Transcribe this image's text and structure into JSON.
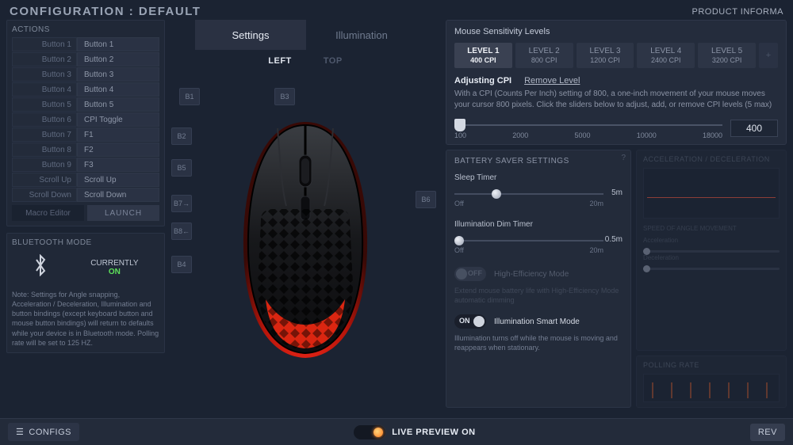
{
  "header": {
    "title": "CONFIGURATION : DEFAULT",
    "right": "PRODUCT INFORMA"
  },
  "actions": {
    "title": "ACTIONS",
    "rows": [
      {
        "label": "Button 1",
        "value": "Button 1"
      },
      {
        "label": "Button 2",
        "value": "Button 2"
      },
      {
        "label": "Button 3",
        "value": "Button 3"
      },
      {
        "label": "Button 4",
        "value": "Button 4"
      },
      {
        "label": "Button 5",
        "value": "Button 5"
      },
      {
        "label": "Button 6",
        "value": "CPI Toggle"
      },
      {
        "label": "Button 7",
        "value": "F1"
      },
      {
        "label": "Button 8",
        "value": "F2"
      },
      {
        "label": "Button 9",
        "value": "F3"
      },
      {
        "label": "Scroll Up",
        "value": "Scroll Up"
      },
      {
        "label": "Scroll Down",
        "value": "Scroll Down"
      }
    ],
    "macro_label": "Macro Editor",
    "launch": "LAUNCH"
  },
  "bluetooth": {
    "title": "BLUETOOTH MODE",
    "currently": "CURRENTLY",
    "on": "ON",
    "note": "Note: Settings for Angle snapping, Acceleration / Deceleration, Illumination and button bindings (except keyboard button and mouse button bindings) will return to defaults while your device is in Bluetooth mode. Polling rate will be set to 125 HZ."
  },
  "center": {
    "tabs": {
      "settings": "Settings",
      "illumination": "Illumination"
    },
    "view": {
      "left": "LEFT",
      "top": "TOP"
    },
    "nodes": {
      "b1": "B1",
      "b2": "B2",
      "b3": "B3",
      "b4": "B4",
      "b5": "B5",
      "b6": "B6",
      "b7": "B7→",
      "b8": "B8←"
    }
  },
  "sensitivity": {
    "title": "Mouse Sensitivity Levels",
    "levels": [
      {
        "name": "LEVEL 1",
        "cpi": "400 CPI"
      },
      {
        "name": "LEVEL 2",
        "cpi": "800 CPI"
      },
      {
        "name": "LEVEL 3",
        "cpi": "1200 CPI"
      },
      {
        "name": "LEVEL 4",
        "cpi": "2400 CPI"
      },
      {
        "name": "LEVEL 5",
        "cpi": "3200 CPI"
      }
    ],
    "adjusting": "Adjusting CPI",
    "remove": "Remove Level",
    "desc": "With a CPI (Counts Per Inch) setting of 800, a one-inch movement of your mouse moves your cursor 800 pixels. Click the sliders below to adjust, add, or remove CPI levels (5 max)",
    "ticks": [
      "100",
      "2000",
      "5000",
      "10000",
      "18000"
    ],
    "value": "400"
  },
  "battery": {
    "title": "BATTERY SAVER SETTINGS",
    "sleep": {
      "label": "Sleep Timer",
      "value": "5m",
      "off": "Off",
      "max": "20m"
    },
    "dim": {
      "label": "Illumination Dim Timer",
      "value": "0.5m",
      "off": "Off",
      "max": "20m"
    },
    "hem": {
      "state": "OFF",
      "label": "High-Efficiency Mode"
    },
    "hem_desc": "Extend mouse battery life with High-Efficiency Mode automatic dimming",
    "smart": {
      "state": "ON",
      "label": "Illumination Smart Mode"
    },
    "smart_desc": "Illumination turns off while the mouse is moving and reappears when stationary."
  },
  "side": {
    "accel_title": "ACCELERATION / DECELERATION",
    "speed_title": "SPEED OF ANGLE MOVEMENT",
    "accel": "Acceleration",
    "decel": "Deceleration",
    "polling_title": "POLLING RATE"
  },
  "footer": {
    "configs": "CONFIGS",
    "live": "LIVE PREVIEW ON",
    "rev": "REV"
  }
}
